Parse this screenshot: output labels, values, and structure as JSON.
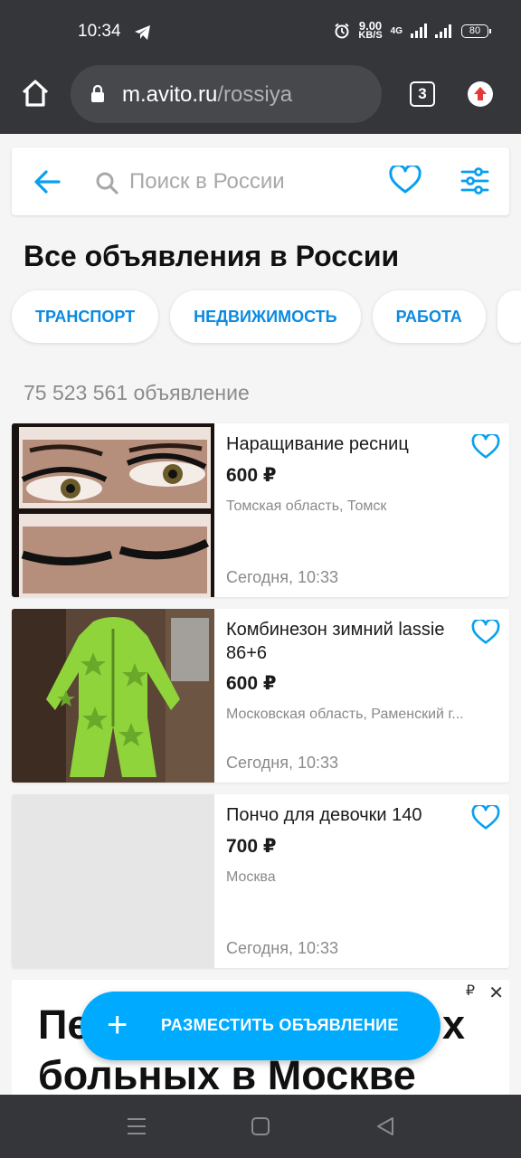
{
  "status_bar": {
    "time": "10:34",
    "speed_value": "9.00",
    "speed_unit": "KB/S",
    "network": "4G",
    "battery": "80"
  },
  "browser": {
    "url_host": "m.avito.ru",
    "url_path": "/rossiya",
    "tab_count": "3"
  },
  "search": {
    "placeholder": "Поиск в России"
  },
  "page_title": "Все объявления в России",
  "categories": [
    "ТРАНСПОРТ",
    "НЕДВИЖИМОСТЬ",
    "РАБОТА"
  ],
  "listing_count": "75 523 561 объявление",
  "listings": [
    {
      "title": "Наращивание ресниц",
      "price": "600 ₽",
      "location": "Томская область, Томск",
      "date": "Сегодня, 10:33"
    },
    {
      "title": "Комбинезон зимний lassie 86+6",
      "price": "600 ₽",
      "location": "Московская область, Раменский г...",
      "date": "Сегодня, 10:33"
    },
    {
      "title": "Пончо для девочки 140",
      "price": "700 ₽",
      "location": "Москва",
      "date": "Сегодня, 10:33"
    }
  ],
  "ad": {
    "text_line1": "Пе",
    "text_line1_end": "х",
    "text_line2": "больных в Москве",
    "ruble": "₽",
    "close": "✕"
  },
  "fab": {
    "label": "РАЗМЕСТИТЬ ОБЪЯВЛЕНИЕ",
    "plus": "+"
  },
  "colors": {
    "accent": "#00aaff",
    "link": "#0a8ae0",
    "chrome": "#35363a"
  }
}
